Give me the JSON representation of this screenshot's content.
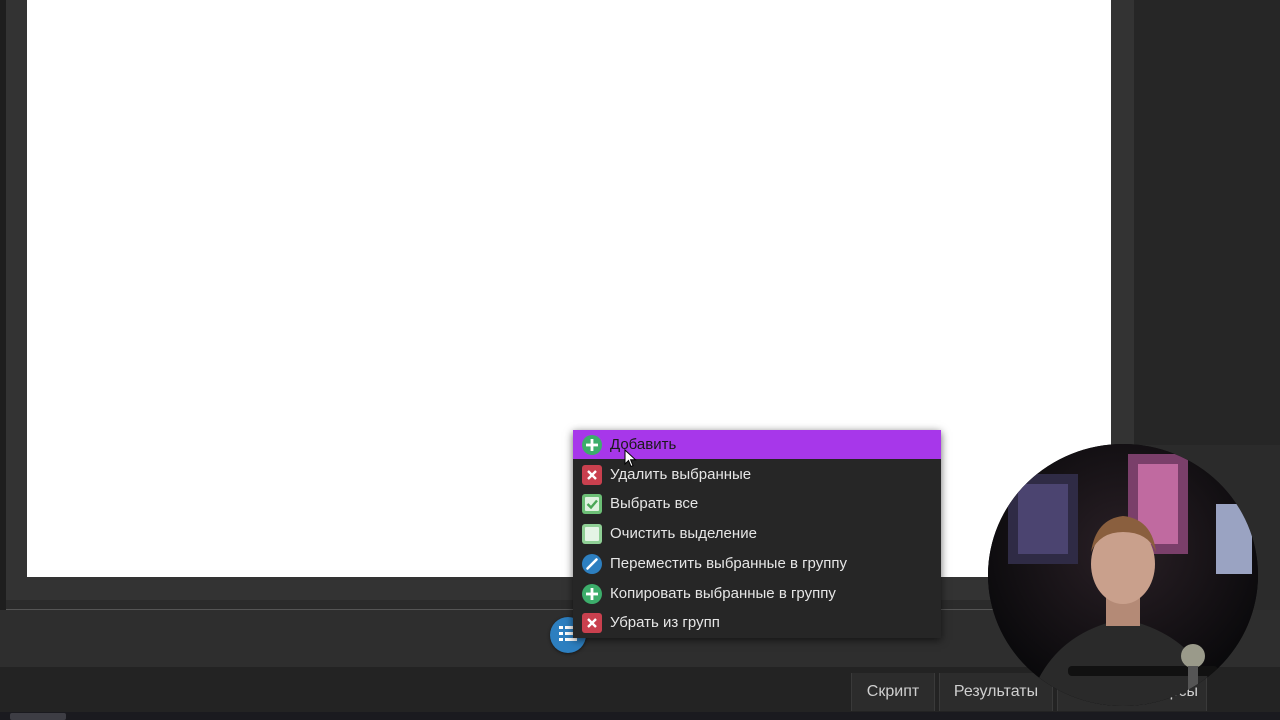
{
  "context_menu": {
    "items": [
      {
        "label": "Добавить",
        "icon": "plus-circle-icon",
        "color": "#3cae6b",
        "active": true
      },
      {
        "label": "Удалить выбранные",
        "icon": "close-square-icon",
        "color": "#c9404e"
      },
      {
        "label": "Выбрать все",
        "icon": "check-square-icon",
        "color": "#6cbf76"
      },
      {
        "label": "Очистить выделение",
        "icon": "empty-square-icon",
        "color": "#8fcf95"
      },
      {
        "label": "Переместить выбранные в группу",
        "icon": "pencil-circle-icon",
        "color": "#2d7fc0"
      },
      {
        "label": "Копировать выбранные в группу",
        "icon": "plus-circle-icon",
        "color": "#3cae6b"
      },
      {
        "label": "Убрать из групп",
        "icon": "close-square-icon",
        "color": "#c9404e"
      }
    ],
    "highlight_color": "#a737ea"
  },
  "fab": {
    "icon": "list-icon",
    "color": "#2d7fc0"
  },
  "tabs": [
    {
      "label": "Скрипт"
    },
    {
      "label": "Результаты"
    },
    {
      "label": "ресурсы"
    }
  ]
}
